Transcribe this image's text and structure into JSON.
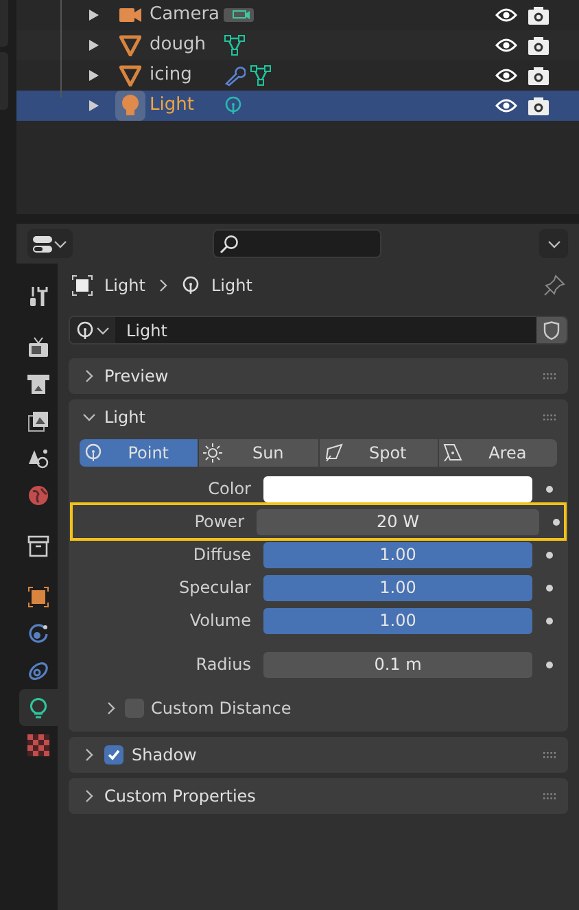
{
  "outliner": {
    "rows": [
      {
        "label": "Camera",
        "kind": "camera",
        "data_icons": [
          {
            "kind": "camera_data"
          }
        ],
        "selected": false
      },
      {
        "label": "dough",
        "kind": "mesh",
        "data_icons": [
          {
            "kind": "mesh_data"
          }
        ],
        "selected": false
      },
      {
        "label": "icing",
        "kind": "mesh",
        "data_icons": [
          {
            "kind": "modifier"
          },
          {
            "kind": "mesh_data"
          }
        ],
        "selected": false
      },
      {
        "label": "Light",
        "kind": "light",
        "data_icons": [
          {
            "kind": "light_data"
          }
        ],
        "selected": true
      }
    ]
  },
  "properties": {
    "sidebar_tabs": [
      {
        "kind": "tool",
        "selected": false
      },
      {
        "kind": "render",
        "selected": false
      },
      {
        "kind": "output",
        "selected": false
      },
      {
        "kind": "view_layer",
        "selected": false
      },
      {
        "kind": "scene",
        "selected": false
      },
      {
        "kind": "world",
        "selected": false
      },
      {
        "kind": "collection",
        "selected": false
      },
      {
        "kind": "object",
        "selected": false
      },
      {
        "kind": "physics",
        "selected": false
      },
      {
        "kind": "constraints",
        "selected": false
      },
      {
        "kind": "light",
        "selected": true
      },
      {
        "kind": "texture",
        "selected": false
      }
    ],
    "breadcrumb": [
      "Light",
      "Light"
    ],
    "datablock": {
      "value": "Light"
    },
    "panels": [
      {
        "kind": "plain",
        "title": "Preview",
        "expanded": false
      },
      {
        "kind": "light",
        "title": "Light",
        "expanded": true,
        "light_types": [
          {
            "label": "Point",
            "selected": true
          },
          {
            "label": "Sun",
            "selected": false
          },
          {
            "label": "Spot",
            "selected": false
          },
          {
            "label": "Area",
            "selected": false
          }
        ],
        "fields": [
          {
            "kind": "color",
            "label": "Color",
            "color": "#ffffff",
            "highlighted": false
          },
          {
            "kind": "number",
            "label": "Power",
            "value": "20 W",
            "highlighted": true
          },
          {
            "kind": "slider",
            "label": "Diffuse",
            "value": "1.00",
            "level": 1,
            "highlighted": false
          },
          {
            "kind": "slider",
            "label": "Specular",
            "value": "1.00",
            "level": 1,
            "highlighted": false
          },
          {
            "kind": "slider",
            "label": "Volume",
            "value": "1.00",
            "level": 1,
            "highlighted": false
          },
          {
            "kind": "number",
            "label": "Radius",
            "value": "0.1 m",
            "highlighted": false
          }
        ],
        "subpanel": {
          "title": "Custom Distance",
          "expanded": false,
          "checked": false
        }
      },
      {
        "kind": "checkbox",
        "title": "Shadow",
        "expanded": false,
        "checked": true
      },
      {
        "kind": "plain",
        "title": "Custom Properties",
        "expanded": false
      }
    ]
  }
}
